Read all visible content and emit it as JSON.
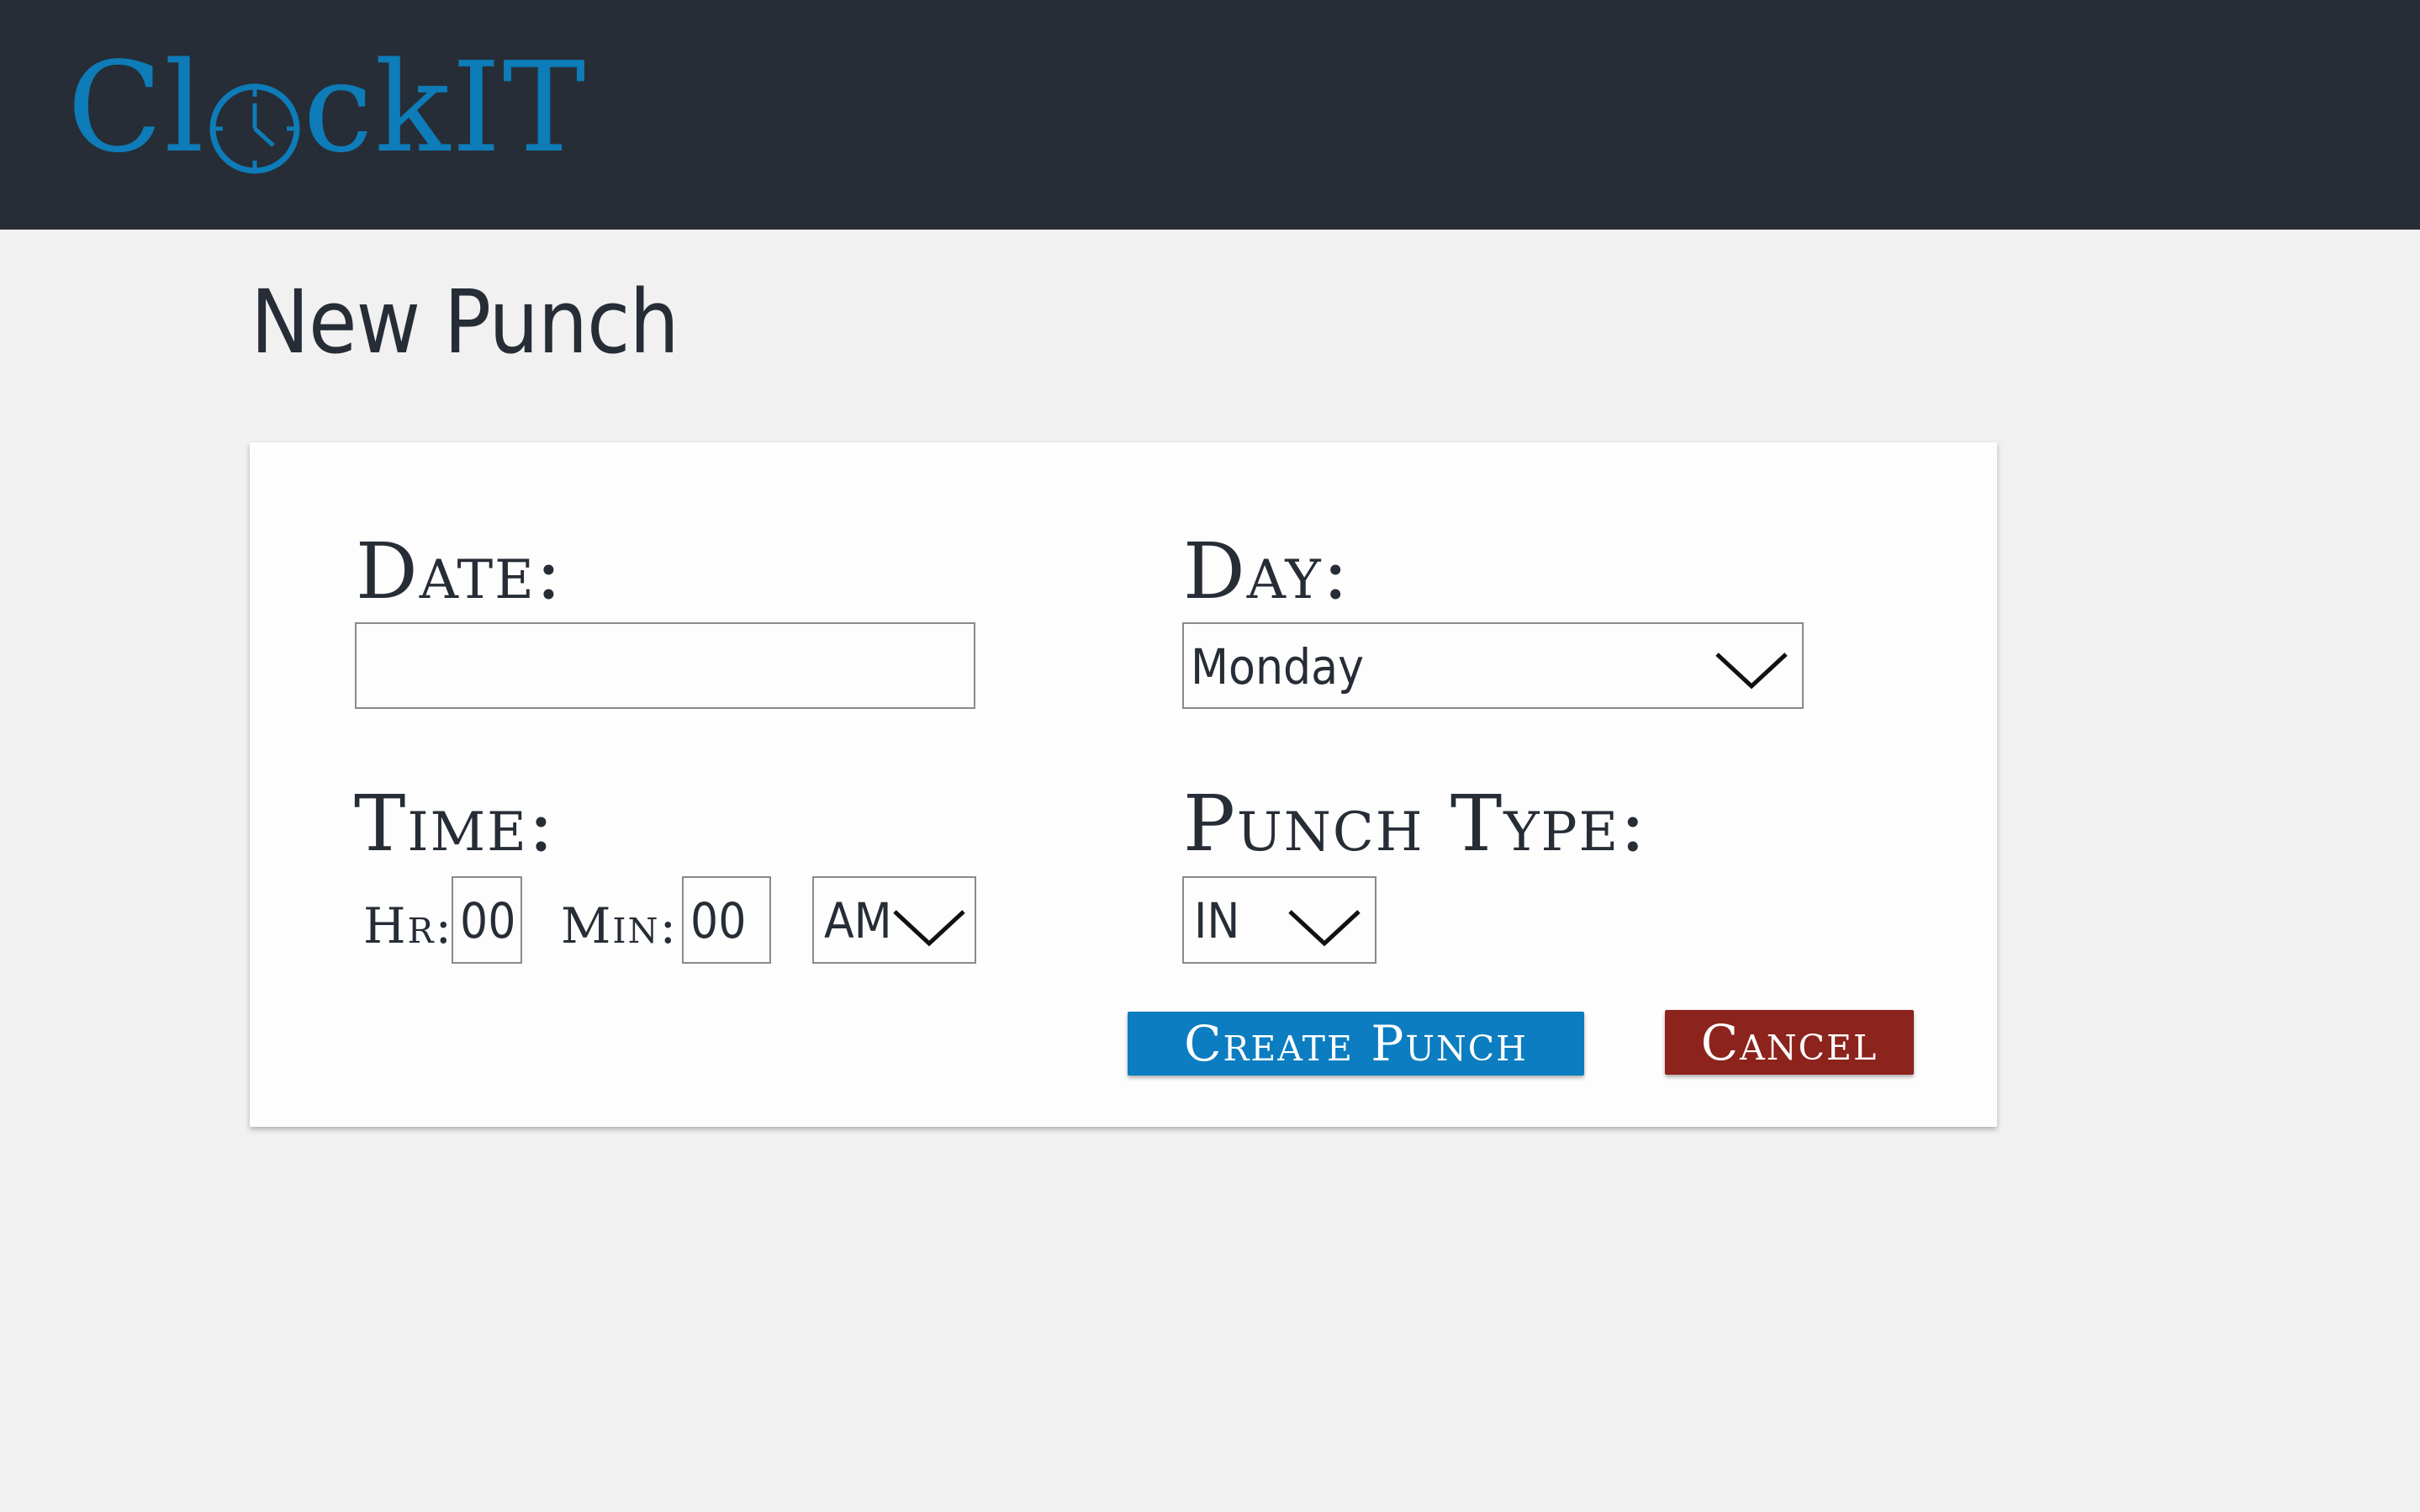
{
  "app": {
    "logo_text_pre": "Cl",
    "logo_text_post": "ckIT",
    "logo_aria": "ClockIT"
  },
  "page": {
    "title": "New Punch"
  },
  "form": {
    "date_label": "Date:",
    "date_value": "",
    "day_label": "Day:",
    "day_value": "Monday",
    "time_label": "Time:",
    "hr_label": "Hr:",
    "hr_value": "00",
    "min_label": "Min:",
    "min_value": "00",
    "ampm_value": "AM",
    "punch_type_label": "Punch Type:",
    "punch_type_value": "IN",
    "create_label": "Create Punch",
    "cancel_label": "Cancel"
  },
  "colors": {
    "header_bg": "#272d36",
    "brand_blue": "#0d7cb8",
    "create_button": "#0c7dc0",
    "cancel_button": "#8c231d",
    "page_bg": "#f1f1f1"
  },
  "icons": {
    "logo_clock": "clock-icon",
    "dropdown": "chevron-down-icon"
  }
}
